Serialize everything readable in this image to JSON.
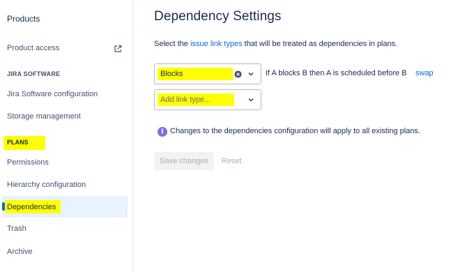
{
  "sidebar": {
    "title": "Products",
    "product_access": "Product access",
    "section_jira": "JIRA SOFTWARE",
    "jira_config": "Jira Software configuration",
    "storage": "Storage management",
    "section_plans": "PLANS",
    "permissions": "Permissions",
    "hierarchy": "Hierarchy configuration",
    "dependencies": "Dependencies",
    "trash": "Trash",
    "archive": "Archive"
  },
  "main": {
    "title": "Dependency Settings",
    "desc_prefix": "Select the ",
    "desc_link": "issue link types",
    "desc_suffix": " that will be treated as dependencies in plans.",
    "select1_value": "Blocks",
    "rule_text": "If A blocks B then A is scheduled before B",
    "swap_label": "swap",
    "select2_placeholder": "Add link type...",
    "info_text": "Changes to the dependencies configuration will apply to all existing plans.",
    "save_label": "Save changes",
    "reset_label": "Reset"
  },
  "colors": {
    "highlight": "#ffff00",
    "link": "#0c66e4",
    "info": "#8270db",
    "active_bg": "#e9f2ff"
  },
  "icons": {
    "external": "external-link-icon",
    "clear": "clear-icon",
    "chevron": "chevron-down-icon",
    "info": "info-icon"
  }
}
